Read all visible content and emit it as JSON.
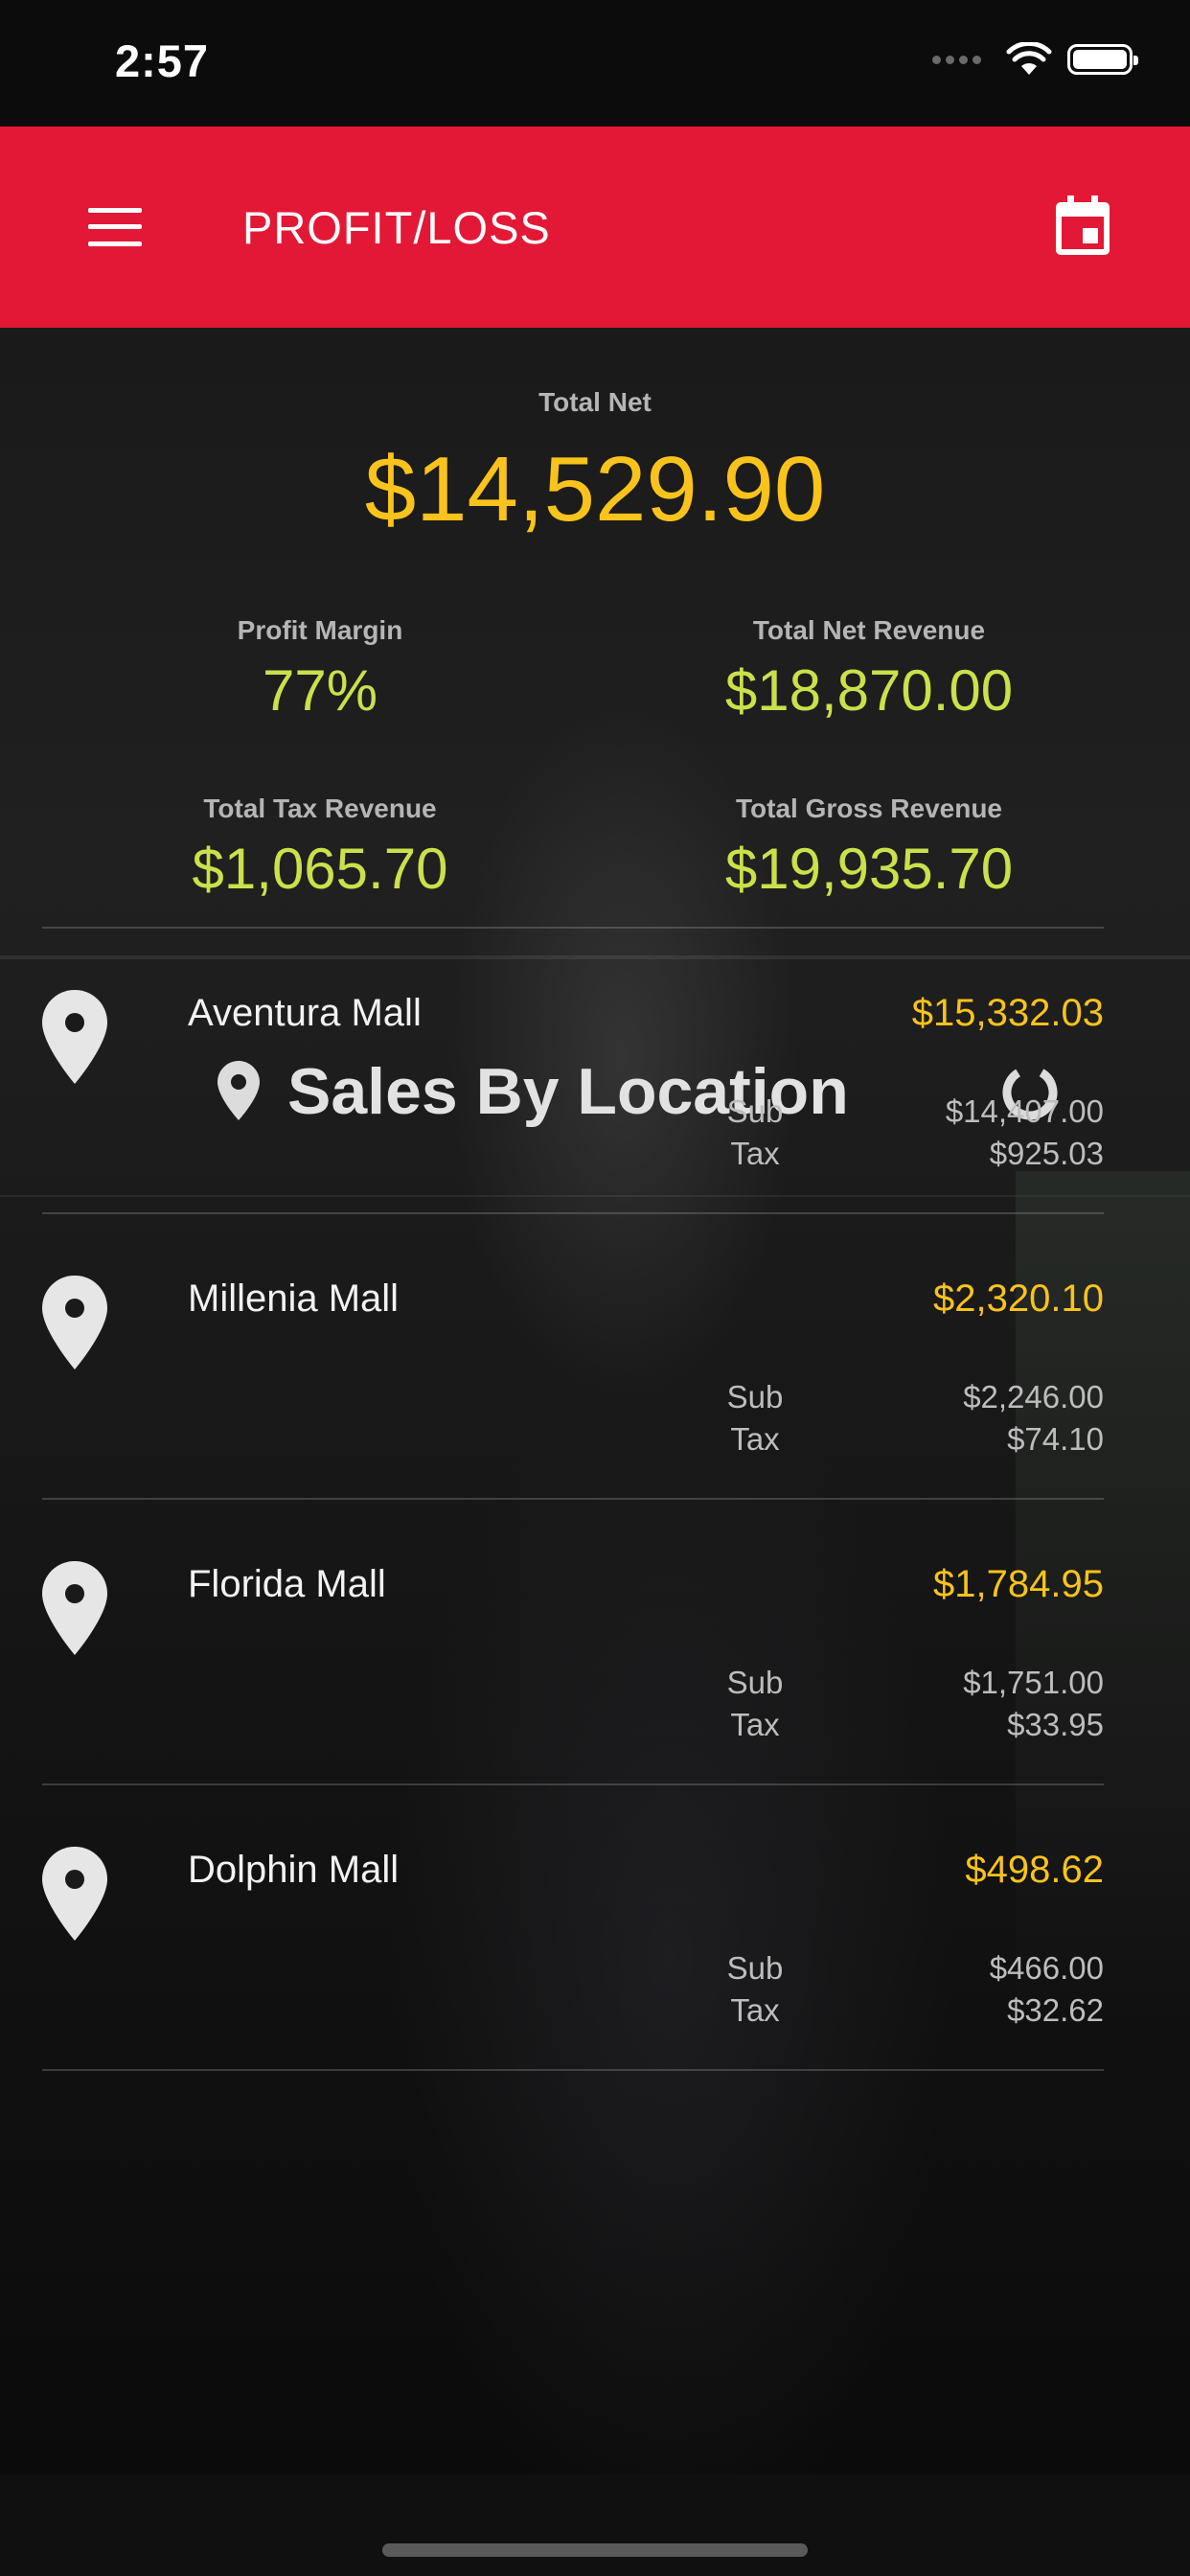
{
  "status_bar": {
    "time": "2:57"
  },
  "app_bar": {
    "title": "PROFIT/LOSS",
    "menu_icon": "menu-icon",
    "calendar_icon": "calendar-icon"
  },
  "summary": {
    "total_net_label": "Total Net",
    "total_net_value": "$14,529.90",
    "metrics": [
      {
        "label": "Profit Margin",
        "value": "77%"
      },
      {
        "label": "Total Net Revenue",
        "value": "$18,870.00"
      },
      {
        "label": "Total Tax Revenue",
        "value": "$1,065.70"
      },
      {
        "label": "Total Gross Revenue",
        "value": "$19,935.70"
      }
    ]
  },
  "sales_section": {
    "title": "Sales By Location",
    "title_icon": "location-pin-icon",
    "refresh_icon": "refresh-icon"
  },
  "locations": [
    {
      "name": "Aventura Mall",
      "total": "$15,332.03",
      "sub_label": "Sub",
      "sub": "$14,407.00",
      "tax_label": "Tax",
      "tax": "$925.03"
    },
    {
      "name": "Millenia Mall",
      "total": "$2,320.10",
      "sub_label": "Sub",
      "sub": "$2,246.00",
      "tax_label": "Tax",
      "tax": "$74.10"
    },
    {
      "name": "Florida Mall",
      "total": "$1,784.95",
      "sub_label": "Sub",
      "sub": "$1,751.00",
      "tax_label": "Tax",
      "tax": "$33.95"
    },
    {
      "name": "Dolphin Mall",
      "total": "$498.62",
      "sub_label": "Sub",
      "sub": "$466.00",
      "tax_label": "Tax",
      "tax": "$32.62"
    }
  ],
  "colors": {
    "accent": "#e31837",
    "total_yellow": "#f9c31c",
    "metric_green": "#cbe04a"
  }
}
